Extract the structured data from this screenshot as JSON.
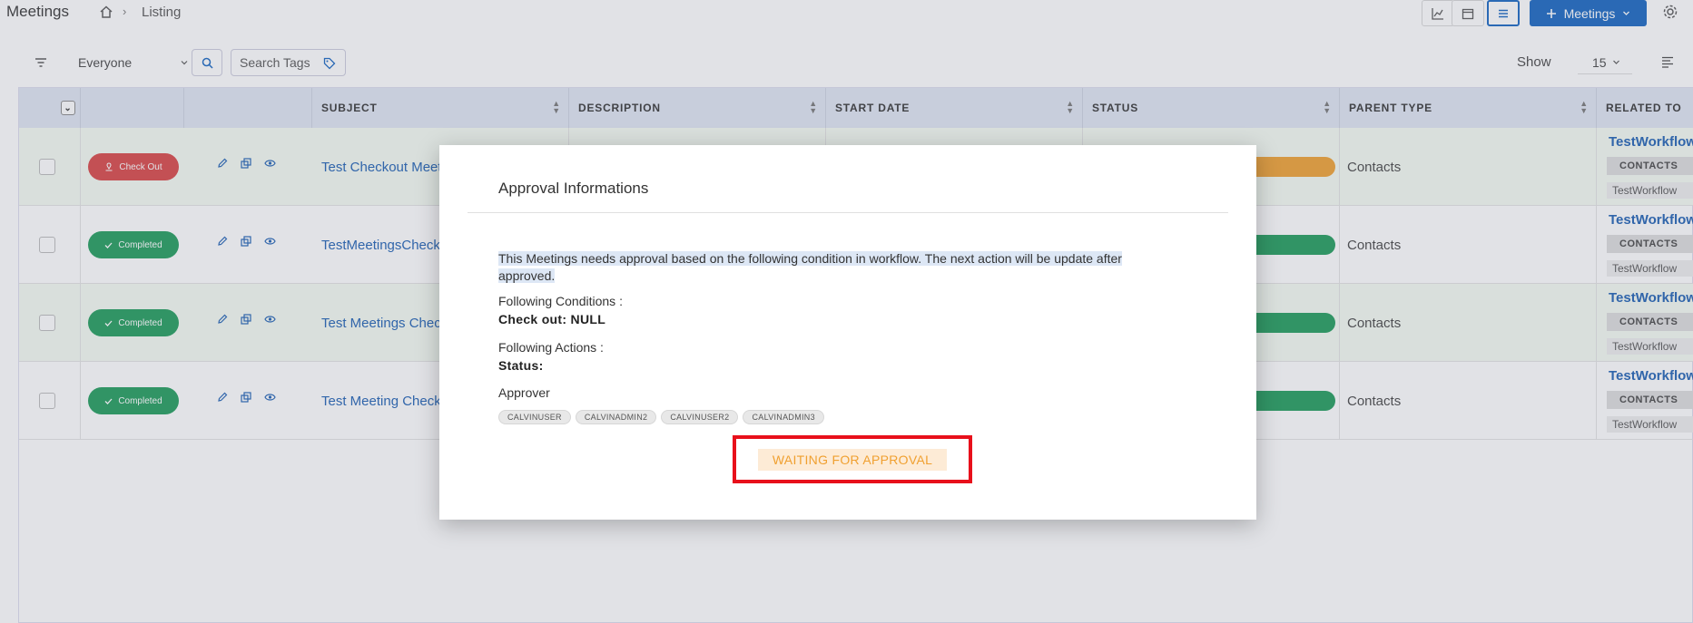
{
  "app": {
    "title": "Meetings",
    "breadcrumb_current": "Listing",
    "new_button_label": "Meetings"
  },
  "filters": {
    "owner_selected": "Everyone",
    "tags_placeholder": "Search Tags",
    "show_label": "Show",
    "page_size": "15"
  },
  "table": {
    "columns": [
      "SUBJECT",
      "DESCRIPTION",
      "START DATE",
      "STATUS",
      "PARENT TYPE",
      "RELATED TO"
    ],
    "rows": [
      {
        "action_label": "Check Out",
        "subject": "Test Checkout Meeting",
        "parent_type": "Contacts",
        "related_link": "TestWorkflow",
        "related_badge": "CONTACTS",
        "related_sub": "TestWorkflow"
      },
      {
        "action_label": "Completed",
        "subject": "TestMeetingsCheckout",
        "parent_type": "Contacts",
        "related_link": "TestWorkflow",
        "related_badge": "CONTACTS",
        "related_sub": "TestWorkflow"
      },
      {
        "action_label": "Completed",
        "subject": "Test Meetings Checkout",
        "parent_type": "Contacts",
        "related_link": "TestWorkflow",
        "related_badge": "CONTACTS",
        "related_sub": "TestWorkflow"
      },
      {
        "action_label": "Completed",
        "subject": "Test Meeting Checkout",
        "parent_type": "Contacts",
        "related_link": "TestWorkflow",
        "related_badge": "CONTACTS",
        "related_sub": "TestWorkflow"
      }
    ]
  },
  "modal": {
    "title": "Approval Informations",
    "message": "This Meetings needs approval based on the following condition in workflow. The next action will be update after approved.",
    "conditions_label": "Following Conditions :",
    "conditions_value": "Check out: NULL",
    "actions_label": "Following Actions :",
    "actions_value": "Status:",
    "approver_label": "Approver",
    "approvers": [
      "CALVINUSER",
      "CALVINADMIN2",
      "CALVINUSER2",
      "CALVINADMIN3"
    ],
    "waiting_label": "WAITING FOR APPROVAL"
  },
  "colors": {
    "primary": "#1565c0",
    "checkout_red": "#d94444",
    "completed_green": "#1e9c5a",
    "status_orange": "#f0a030",
    "highlight_red": "#e8101b"
  },
  "icons": [
    "home-icon",
    "chart-icon",
    "calendar-icon",
    "list-icon",
    "plus-icon",
    "gear-icon",
    "filter-icon",
    "search-icon",
    "tag-icon",
    "columns-icon",
    "pencil-icon",
    "copy-icon",
    "eye-icon",
    "check-icon",
    "location-pin-icon"
  ]
}
